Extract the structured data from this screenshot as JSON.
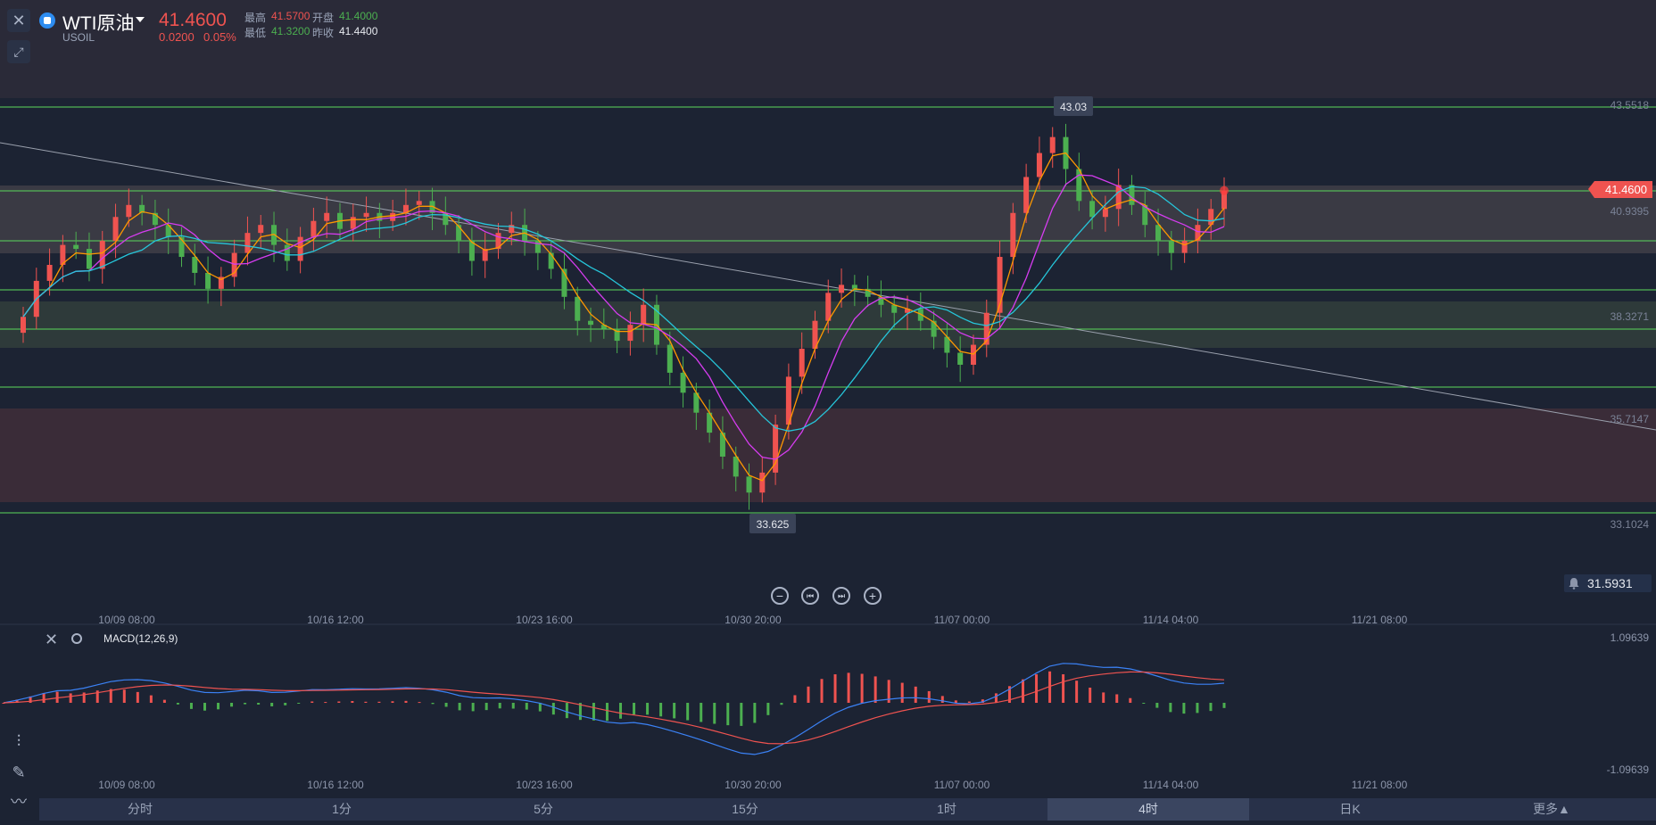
{
  "symbol": {
    "name": "WTI原油",
    "code": "USOIL",
    "price": "41.4600",
    "change": "0.0200",
    "change_pct": "0.05%"
  },
  "stats": {
    "high_label": "最高",
    "high": "41.5700",
    "open_label": "开盘",
    "open": "41.4000",
    "low_label": "最低",
    "low": "41.3200",
    "prev_close_label": "昨收",
    "prev_close": "41.4400"
  },
  "price_axis": {
    "labels": [
      "43.5518",
      "40.9395",
      "38.3271",
      "35.7147",
      "33.1024"
    ],
    "current_price_tag": "41.4600",
    "alert_value": "31.5931"
  },
  "markers": {
    "high_label": "43.03",
    "low_label": "33.625"
  },
  "time_axis": {
    "labels": [
      "10/09 08:00",
      "10/16 12:00",
      "10/23 16:00",
      "10/30 20:00",
      "11/07 00:00",
      "11/14 04:00",
      "11/21 08:00"
    ]
  },
  "macd": {
    "title": "MACD(12,26,9)",
    "axis_top": "1.09639",
    "axis_bottom": "-1.09639"
  },
  "timeframes": [
    "分时",
    "1分",
    "5分",
    "15分",
    "1时",
    "4时",
    "日K",
    "更多▲"
  ],
  "active_timeframe": "4时",
  "colors": {
    "up": "#ef5350",
    "down": "#4caf50",
    "ma_orange": "#ff9800",
    "ma_purple": "#d63cf0",
    "ma_cyan": "#26c6da",
    "macd_dif": "#3b82f6",
    "macd_dea": "#ef5350",
    "level_line": "#5bd85b"
  },
  "chart_data": {
    "type": "candlestick",
    "horizontal_levels": [
      43.5518,
      41.46,
      40.2,
      38.98,
      38.0,
      36.55,
      33.4
    ],
    "candles_close": [
      38.3,
      39.2,
      39.6,
      40.1,
      40.0,
      39.5,
      40.2,
      40.8,
      41.1,
      40.9,
      40.6,
      40.3,
      39.8,
      39.4,
      39.0,
      39.3,
      39.9,
      40.4,
      40.6,
      40.1,
      39.7,
      40.3,
      40.7,
      40.9,
      40.5,
      40.8,
      40.9,
      40.7,
      40.9,
      41.1,
      41.2,
      40.9,
      40.6,
      40.2,
      39.7,
      40.0,
      40.4,
      40.6,
      40.2,
      39.9,
      39.5,
      38.8,
      38.2,
      38.1,
      38.0,
      37.7,
      38.1,
      38.6,
      37.6,
      36.9,
      36.4,
      35.9,
      35.4,
      34.8,
      34.3,
      33.9,
      34.4,
      35.6,
      36.8,
      37.5,
      38.2,
      38.9,
      39.1,
      39.0,
      38.8,
      38.6,
      38.4,
      38.5,
      38.2,
      37.8,
      37.4,
      37.1,
      37.6,
      38.4,
      39.8,
      40.9,
      41.8,
      42.4,
      42.8,
      42.0,
      41.2,
      40.8,
      41.0,
      41.6,
      41.1,
      40.6,
      40.2,
      39.9,
      40.2,
      40.6,
      41.0,
      41.46
    ],
    "macd_axis_range": [
      -1.09639,
      1.09639
    ]
  }
}
